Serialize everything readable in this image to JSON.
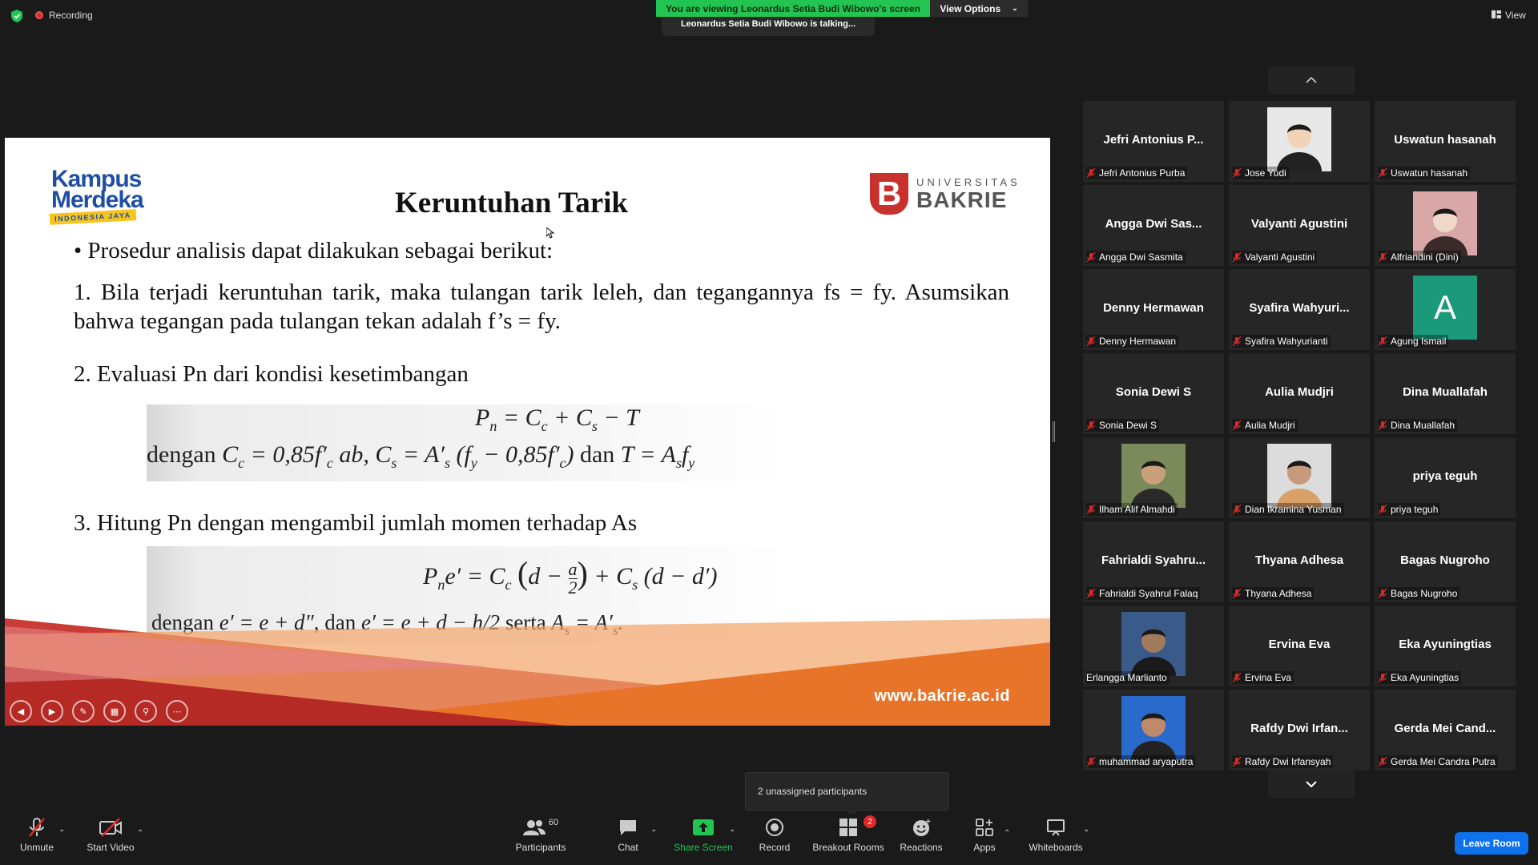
{
  "topbar": {
    "recording_label": "Recording",
    "viewing_banner": "You are viewing Leonardus Setia Budi Wibowo's screen",
    "view_options_label": "View Options",
    "talking_text": "Leonardus Setia Budi Wibowo is talking...",
    "view_label": "View"
  },
  "slide": {
    "logo_line1": "Kampus",
    "logo_line2": "Merdeka",
    "logo_tag": "INDONESIA JAYA",
    "title": "Keruntuhan Tarik",
    "univ_small": "UNIVERSITAS",
    "univ_big": "BAKRIE",
    "bullet": "• Prosedur analisis dapat dilakukan sebagai berikut:",
    "point1": "1. Bila terjadi keruntuhan tarik, maka tulangan tarik leleh, dan tegangannya fs = fy. Asumsikan bahwa tegangan pada tulangan tekan adalah f’s = fy.",
    "point2": "2. Evaluasi Pn dari kondisi kesetimbangan",
    "point3": "3. Hitung Pn dengan mengambil jumlah momen terhadap As",
    "website": "www.bakrie.ac.id",
    "accent_colors": [
      "#c7332c",
      "#e8742a",
      "#f4a469"
    ]
  },
  "gallery": {
    "tiles": [
      {
        "name": "Jefri Antonius P...",
        "label": "Jefri Antonius Purba",
        "type": "name",
        "muted": true
      },
      {
        "name": "",
        "label": "Jose Yudi",
        "type": "photo",
        "muted": true
      },
      {
        "name": "Uswatun hasanah",
        "label": "Uswatun hasanah",
        "type": "name",
        "muted": true
      },
      {
        "name": "Angga Dwi Sas...",
        "label": "Angga Dwi Sasmita",
        "type": "name",
        "muted": true
      },
      {
        "name": "Valyanti Agustini",
        "label": "Valyanti Agustini",
        "type": "name",
        "muted": true
      },
      {
        "name": "",
        "label": "Alfriandini (Dini)",
        "type": "photo",
        "muted": true
      },
      {
        "name": "Denny Hermawan",
        "label": "Denny Hermawan",
        "type": "name",
        "muted": true
      },
      {
        "name": "Syafira  Wahyuri...",
        "label": "Syafira Wahyurianti",
        "type": "name",
        "muted": true
      },
      {
        "name": "A",
        "label": "Agung Ismail",
        "type": "avatar",
        "muted": true
      },
      {
        "name": "Sonia Dewi S",
        "label": "Sonia Dewi S",
        "type": "name",
        "muted": true
      },
      {
        "name": "Aulia Mudjri",
        "label": "Aulia Mudjri",
        "type": "name",
        "muted": true
      },
      {
        "name": "Dina Muallafah",
        "label": "Dina Muallafah",
        "type": "name",
        "muted": true
      },
      {
        "name": "",
        "label": "Ilham Alif Almahdi",
        "type": "photo",
        "muted": true
      },
      {
        "name": "",
        "label": "Dian Ikramina Yusman",
        "type": "photo",
        "muted": true
      },
      {
        "name": "priya teguh",
        "label": "priya teguh",
        "type": "name",
        "muted": true
      },
      {
        "name": "Fahrialdi  Syahru...",
        "label": "Fahrialdi Syahrul Falaq",
        "type": "name",
        "muted": true
      },
      {
        "name": "Thyana Adhesa",
        "label": "Thyana Adhesa",
        "type": "name",
        "muted": true
      },
      {
        "name": "Bagas Nugroho",
        "label": "Bagas Nugroho",
        "type": "name",
        "muted": true
      },
      {
        "name": "",
        "label": "Erlangga Marlianto",
        "type": "photo",
        "muted": false
      },
      {
        "name": "Ervina Eva",
        "label": "Ervina Eva",
        "type": "name",
        "muted": true
      },
      {
        "name": "Eka Ayuningtias",
        "label": "Eka Ayuningtias",
        "type": "name",
        "muted": true
      },
      {
        "name": "",
        "label": "muhammad aryaputra",
        "type": "photo",
        "muted": true
      },
      {
        "name": "Rafdy Dwi Irfan...",
        "label": "Rafdy Dwi Irfansyah",
        "type": "name",
        "muted": true
      },
      {
        "name": "Gerda Mei Cand...",
        "label": "Gerda Mei Candra Putra",
        "type": "name",
        "muted": true
      }
    ]
  },
  "popup": {
    "unassigned": "2 unassigned participants"
  },
  "toolbar": {
    "unmute": "Unmute",
    "start_video": "Start Video",
    "participants": "Participants",
    "participants_count": "60",
    "chat": "Chat",
    "share_screen": "Share Screen",
    "record": "Record",
    "breakout_rooms": "Breakout Rooms",
    "breakout_badge": "2",
    "reactions": "Reactions",
    "apps": "Apps",
    "whiteboards": "Whiteboards",
    "leave_room": "Leave Room"
  }
}
